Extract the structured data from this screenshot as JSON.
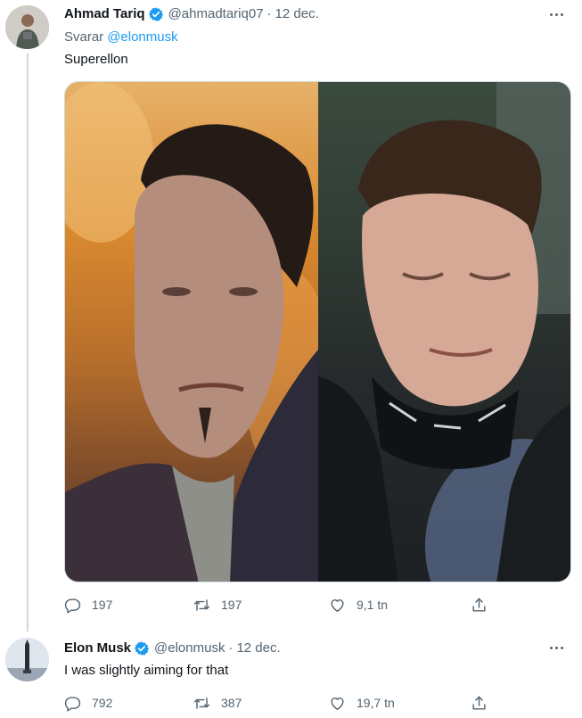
{
  "tweets": [
    {
      "display_name": "Ahmad Tariq",
      "handle": "@ahmadtariq07",
      "separator": "·",
      "date": "12 dec.",
      "reply_prefix": "Svarar",
      "reply_mention": "@elonmusk",
      "text": "Superellon",
      "replies": "197",
      "retweets": "197",
      "likes": "9,1 tn",
      "verified": true
    },
    {
      "display_name": "Elon Musk",
      "handle": "@elonmusk",
      "separator": "·",
      "date": "12 dec.",
      "text": "I was slightly aiming for that",
      "replies": "792",
      "retweets": "387",
      "likes": "19,7 tn",
      "verified": true
    }
  ],
  "colors": {
    "accent": "#1d9bf0",
    "secondary_text": "#536471",
    "primary_text": "#0f1419",
    "thread_line": "#cfd9de"
  },
  "icons": [
    "verified-badge-icon",
    "more-icon",
    "reply-icon",
    "retweet-icon",
    "like-icon",
    "share-icon"
  ]
}
